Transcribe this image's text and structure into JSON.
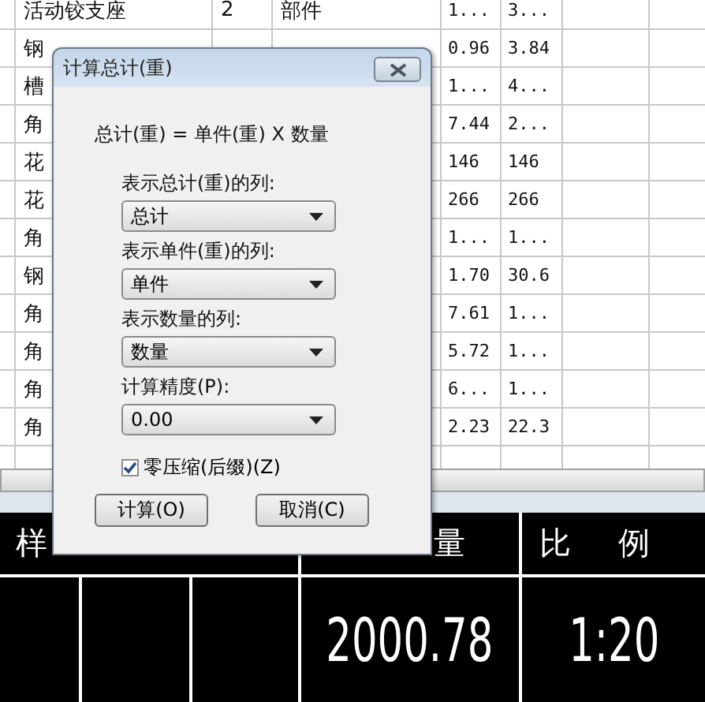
{
  "table": {
    "rows": [
      {
        "name": "活动铰支座",
        "quantity": "2",
        "material": "部件",
        "column_5": "1...",
        "column_6": "3..."
      },
      {
        "name": "钢",
        "column_5": "0.96",
        "column_6": "3.84"
      },
      {
        "name": "槽",
        "column_5": "1...",
        "column_6": "4..."
      },
      {
        "name": "角",
        "column_5": "7.44",
        "column_6": "2..."
      },
      {
        "name": "花",
        "column_5": "146",
        "column_6": "146"
      },
      {
        "name": "花",
        "column_5": "266",
        "column_6": "266"
      },
      {
        "name": "角",
        "column_5": "1...",
        "column_6": "1..."
      },
      {
        "name": "钢",
        "column_5": "1.70",
        "column_6": "30.6"
      },
      {
        "name": "角",
        "column_5": "7.61",
        "column_6": "1..."
      },
      {
        "name": "角",
        "column_5": "5.72",
        "column_6": "1..."
      },
      {
        "name": "角",
        "column_5": "6...",
        "column_6": "1..."
      },
      {
        "name": "角",
        "column_5": "2.23",
        "column_6": "22.3"
      }
    ]
  },
  "title_block": {
    "header_1": "样",
    "header_2": "量",
    "header_3": "比例",
    "weight": "2000.78",
    "scale": "1:20"
  },
  "dialog": {
    "title": "计算总计(重)",
    "formula": "总计(重) = 单件(重) X 数量",
    "fields": [
      {
        "label": "表示总计(重)的列:",
        "value": "总计"
      },
      {
        "label": "表示单件(重)的列:",
        "value": "单件"
      },
      {
        "label": "表示数量的列:",
        "value": "数量"
      },
      {
        "label": "计算精度(P):",
        "value": "0.00"
      }
    ],
    "checkbox": {
      "label": "零压缩(后缀)(Z)",
      "checked": true
    },
    "buttons": [
      "计算(O)",
      "取消(C)"
    ]
  }
}
